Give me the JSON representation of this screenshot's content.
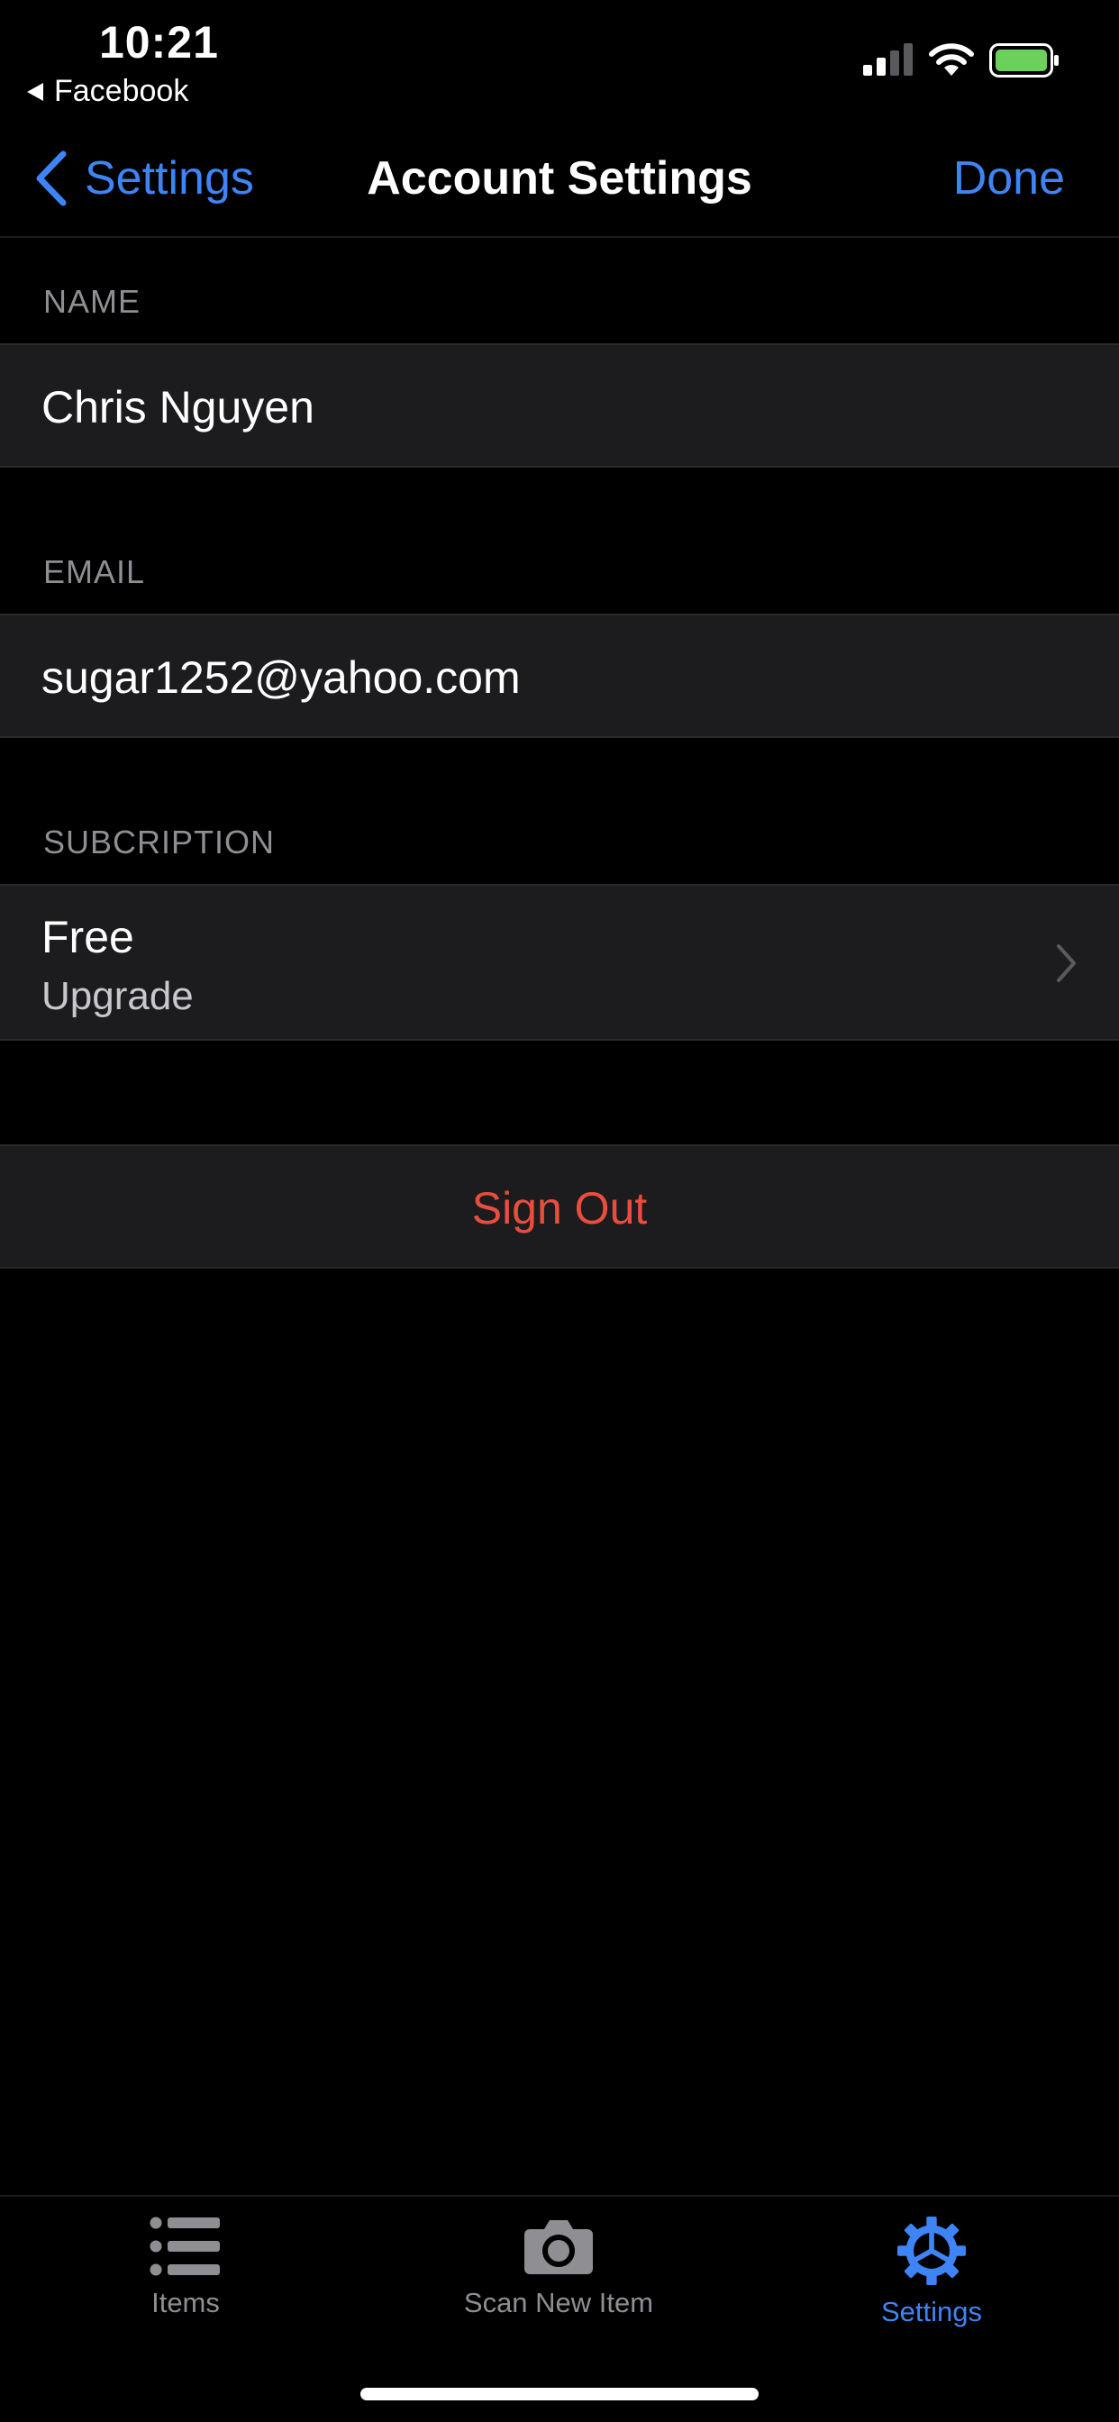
{
  "status_bar": {
    "time": "10:21",
    "back_app": "Facebook",
    "battery_color": "#6cd15b"
  },
  "nav": {
    "back_label": "Settings",
    "title": "Account Settings",
    "done_label": "Done",
    "accent_color": "#3f84f6"
  },
  "sections": {
    "name": {
      "header": "NAME",
      "value": "Chris Nguyen"
    },
    "email": {
      "header": "EMAIL",
      "value": "sugar1252@yahoo.com"
    },
    "subscription": {
      "header": "SUBCRIPTION",
      "plan": "Free",
      "action": "Upgrade"
    }
  },
  "sign_out": {
    "label": "Sign Out",
    "color": "#eb4d3d"
  },
  "tab_bar": {
    "items": [
      {
        "label": "Items",
        "icon": "list-icon",
        "active": false
      },
      {
        "label": "Scan New Item",
        "icon": "camera-icon",
        "active": false
      },
      {
        "label": "Settings",
        "icon": "gear-icon",
        "active": true
      }
    ]
  }
}
